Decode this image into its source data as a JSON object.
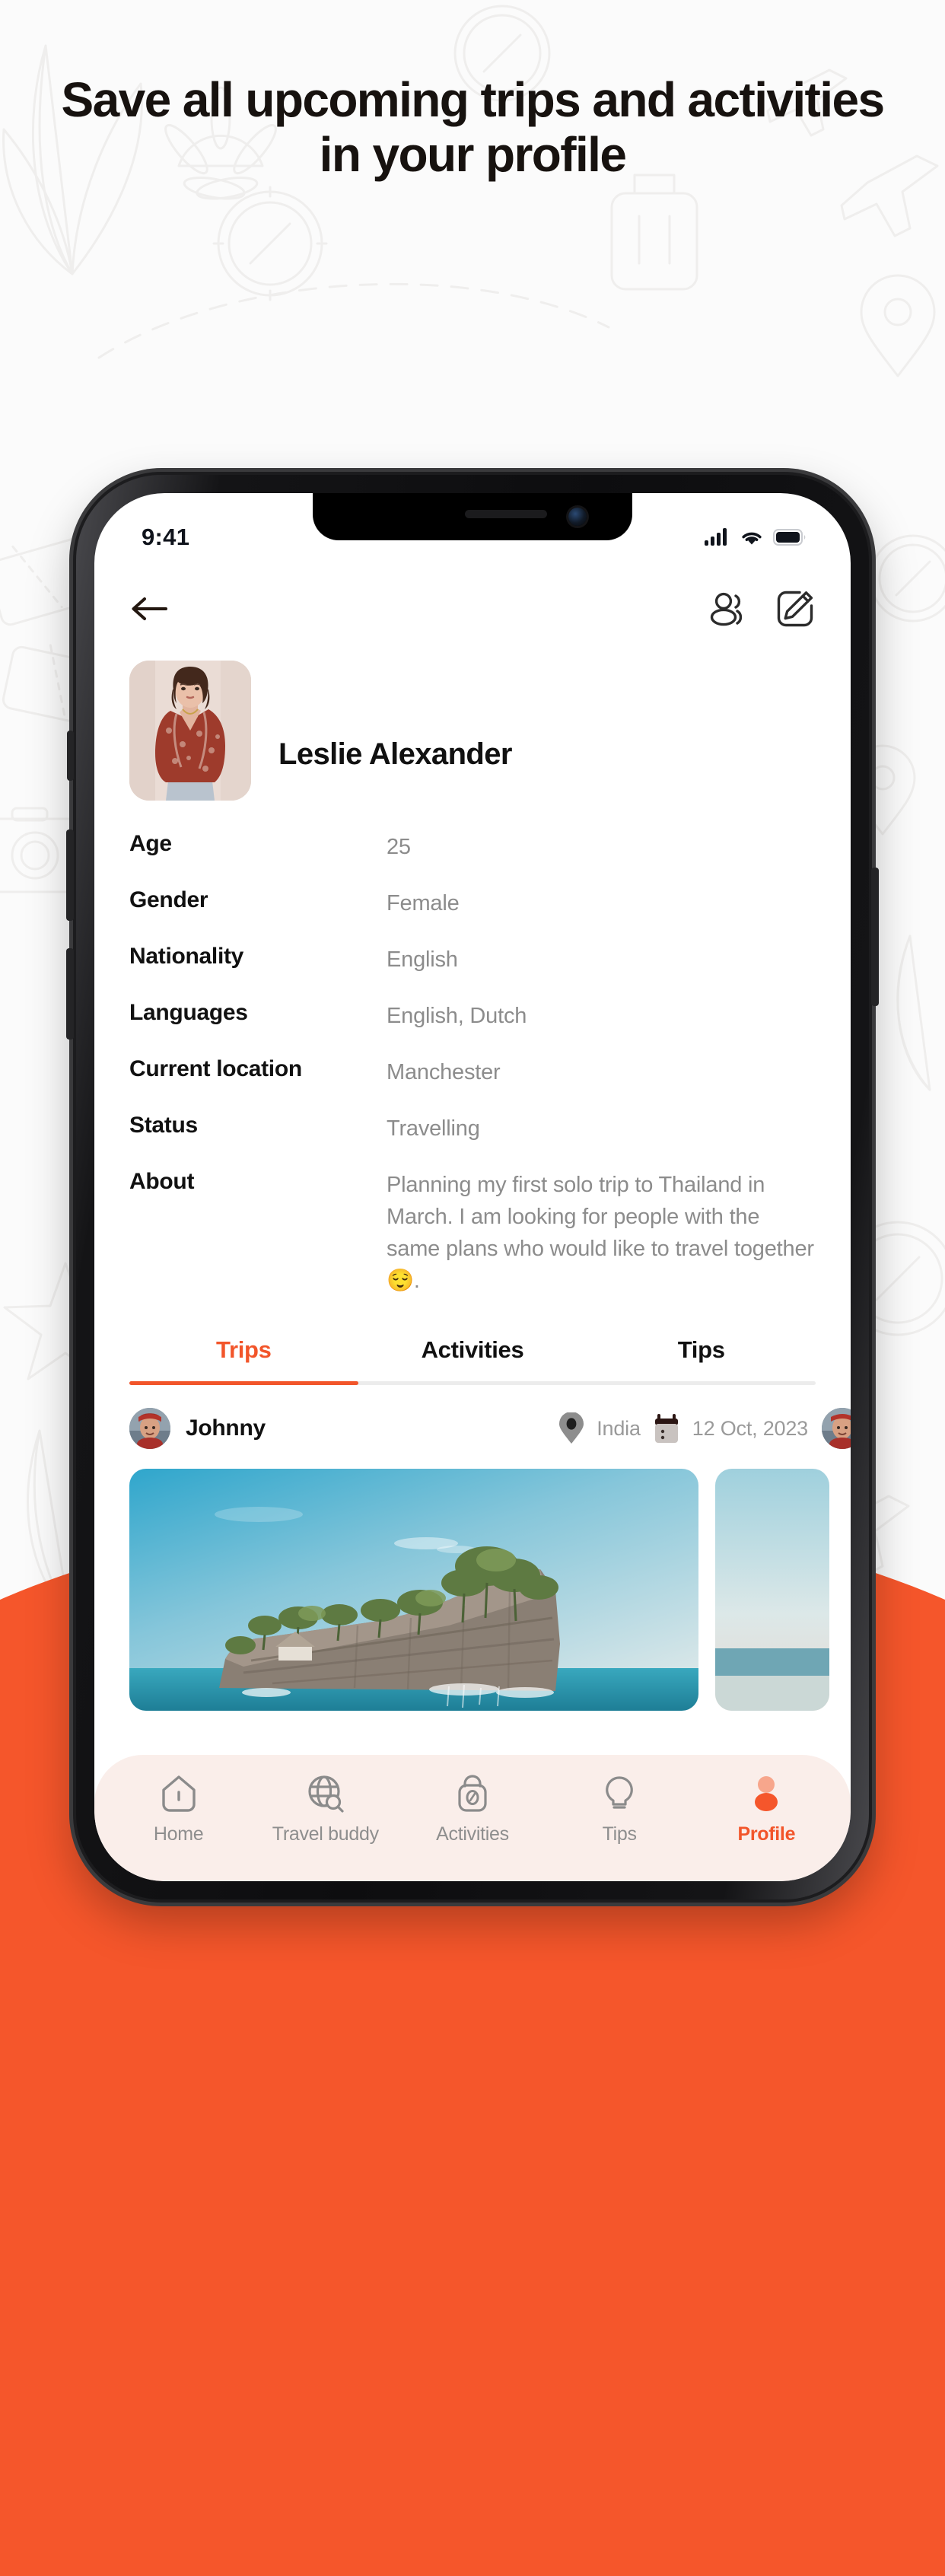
{
  "promo": {
    "headline": "Save all upcoming trips and activities in your profile",
    "accent_color": "#F5562B",
    "background_color": "#FBFBFB"
  },
  "status_bar": {
    "time": "9:41",
    "icons": [
      "cellular-signal-icon",
      "wifi-icon",
      "battery-icon"
    ]
  },
  "header": {
    "back_icon": "arrow-left-icon",
    "actions": [
      {
        "icon": "users-group-icon"
      },
      {
        "icon": "edit-square-icon"
      }
    ]
  },
  "profile": {
    "name": "Leslie Alexander",
    "avatar_icon": "profile-photo",
    "details": [
      {
        "label": "Age",
        "value": "25"
      },
      {
        "label": "Gender",
        "value": "Female"
      },
      {
        "label": "Nationality",
        "value": "English"
      },
      {
        "label": "Languages",
        "value": "English, Dutch"
      },
      {
        "label": "Current location",
        "value": "Manchester"
      },
      {
        "label": "Status",
        "value": "Travelling"
      },
      {
        "label": "About",
        "value": "Planning my first solo trip to Thailand in March. I am looking for people with the same plans who would like to travel together 😌."
      }
    ]
  },
  "tabs": {
    "items": [
      {
        "label": "Trips",
        "active": true
      },
      {
        "label": "Activities",
        "active": false
      },
      {
        "label": "Tips",
        "active": false
      }
    ]
  },
  "trip": {
    "user_name": "Johnny",
    "user_avatar_icon": "avatar",
    "location_icon": "location-pin-icon",
    "location": "India",
    "date_icon": "calendar-icon",
    "date": "12 Oct, 2023",
    "photo_alt": "island-cliff-photo"
  },
  "bottom_nav": {
    "items": [
      {
        "label": "Home",
        "icon": "home-icon",
        "active": false
      },
      {
        "label": "Travel buddy",
        "icon": "globe-search-icon",
        "active": false
      },
      {
        "label": "Activities",
        "icon": "backpack-icon",
        "active": false
      },
      {
        "label": "Tips",
        "icon": "lightbulb-icon",
        "active": false
      },
      {
        "label": "Profile",
        "icon": "person-icon",
        "active": true
      }
    ]
  }
}
